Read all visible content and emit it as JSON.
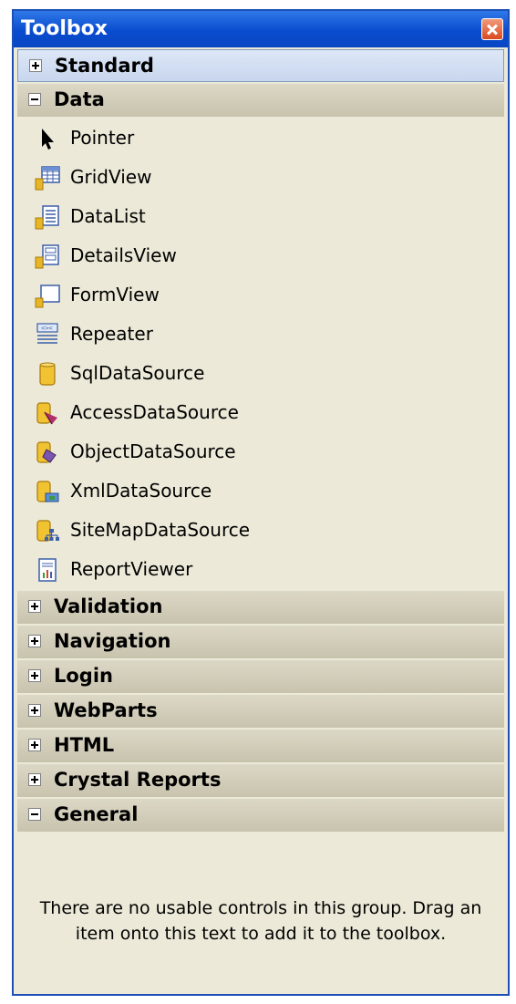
{
  "window": {
    "title": "Toolbox"
  },
  "groups": {
    "standard": {
      "label": "Standard",
      "expanded": false
    },
    "data": {
      "label": "Data",
      "expanded": true,
      "items": [
        {
          "label": "Pointer",
          "icon": "pointer-icon"
        },
        {
          "label": "GridView",
          "icon": "gridview-icon"
        },
        {
          "label": "DataList",
          "icon": "datalist-icon"
        },
        {
          "label": "DetailsView",
          "icon": "detailsview-icon"
        },
        {
          "label": "FormView",
          "icon": "formview-icon"
        },
        {
          "label": "Repeater",
          "icon": "repeater-icon"
        },
        {
          "label": "SqlDataSource",
          "icon": "sqldatasource-icon"
        },
        {
          "label": "AccessDataSource",
          "icon": "accessdatasource-icon"
        },
        {
          "label": "ObjectDataSource",
          "icon": "objectdatasource-icon"
        },
        {
          "label": "XmlDataSource",
          "icon": "xmldatasource-icon"
        },
        {
          "label": "SiteMapDataSource",
          "icon": "sitemapdatasource-icon"
        },
        {
          "label": "ReportViewer",
          "icon": "reportviewer-icon"
        }
      ]
    },
    "validation": {
      "label": "Validation",
      "expanded": false
    },
    "navigation": {
      "label": "Navigation",
      "expanded": false
    },
    "login": {
      "label": "Login",
      "expanded": false
    },
    "webparts": {
      "label": "WebParts",
      "expanded": false
    },
    "html": {
      "label": "HTML",
      "expanded": false
    },
    "crystal": {
      "label": "Crystal Reports",
      "expanded": false
    },
    "general": {
      "label": "General",
      "expanded": true
    }
  },
  "empty_message": "There are no usable controls in this group. Drag an item onto this text to add it to the toolbox.",
  "colors": {
    "title_bar": "#0a4ccf",
    "panel_background": "#ece9d8",
    "group_header": "#c8c3ad",
    "close_button": "#d9491f"
  }
}
